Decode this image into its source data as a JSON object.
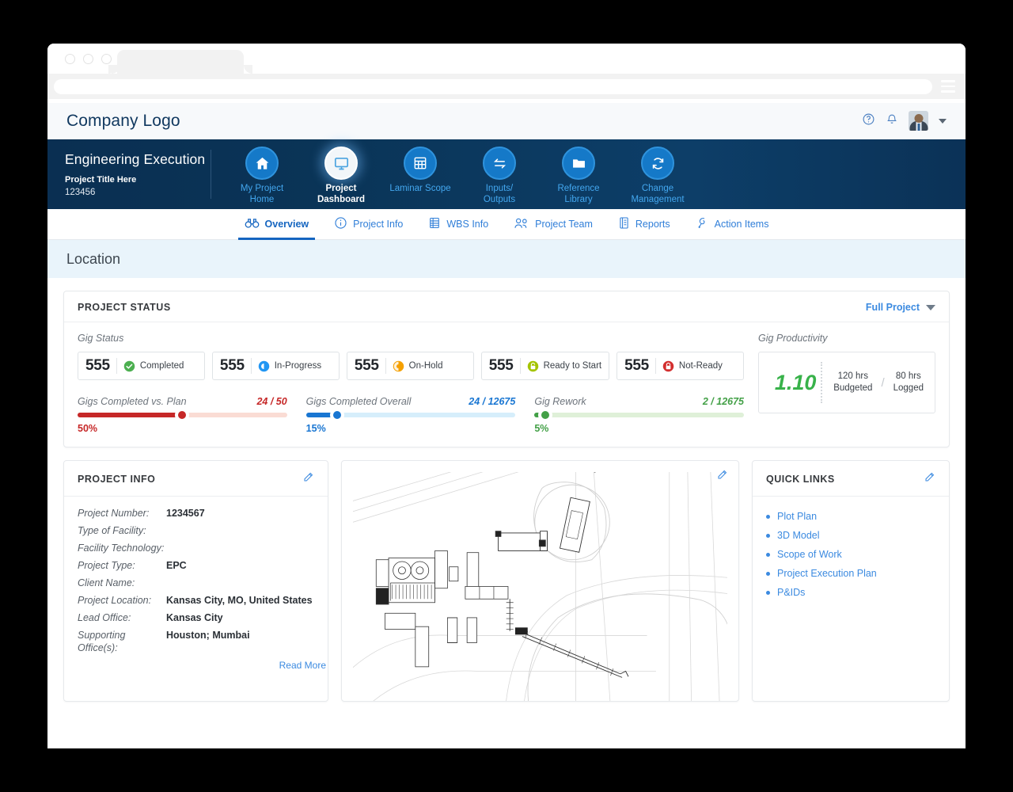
{
  "browser": {
    "tab_label": "",
    "url_value": "",
    "menu_icon": "hamburger-icon"
  },
  "topbar": {
    "logo": "Company Logo",
    "help_icon": "help-circle-icon",
    "bell_icon": "bell-icon",
    "avatar_icon": "user-avatar",
    "chevron_icon": "chevron-down-icon"
  },
  "project_header": {
    "program": "Engineering Execution",
    "title": "Project Title Here",
    "number": "123456"
  },
  "mainnav": [
    {
      "label_line1": "My Project",
      "label_line2": "Home",
      "icon": "home-icon",
      "active": false
    },
    {
      "label_line1": "Project",
      "label_line2": "Dashboard",
      "icon": "monitor-icon",
      "active": true
    },
    {
      "label_line1": "Laminar Scope",
      "label_line2": "",
      "icon": "grid-table-icon",
      "active": false
    },
    {
      "label_line1": "Inputs/",
      "label_line2": "Outputs",
      "icon": "exchange-arrows-icon",
      "active": false
    },
    {
      "label_line1": "Reference",
      "label_line2": "Library",
      "icon": "folder-icon",
      "active": false
    },
    {
      "label_line1": "Change",
      "label_line2": "Management",
      "icon": "refresh-cycle-icon",
      "active": false
    }
  ],
  "subtabs": [
    {
      "label": "Overview",
      "icon": "binoculars-icon",
      "active": true
    },
    {
      "label": "Project Info",
      "icon": "info-circle-icon",
      "active": false
    },
    {
      "label": "WBS Info",
      "icon": "list-table-icon",
      "active": false
    },
    {
      "label": "Project Team",
      "icon": "people-icon",
      "active": false
    },
    {
      "label": "Reports",
      "icon": "report-document-icon",
      "active": false
    },
    {
      "label": "Action Items",
      "icon": "pin-icon",
      "active": false
    }
  ],
  "location_banner": {
    "title": "Location"
  },
  "project_status": {
    "title": "PROJECT STATUS",
    "scope_selector": "Full Project",
    "chevron_icon": "chevron-down-icon",
    "gig_status_label": "Gig Status",
    "chips": [
      {
        "count": "555",
        "label": "Completed",
        "icon": "check-circle-icon",
        "color": "#4caf50"
      },
      {
        "count": "555",
        "label": "In-Progress",
        "icon": "progress-circle-icon",
        "color": "#2196f3"
      },
      {
        "count": "555",
        "label": "On-Hold",
        "icon": "pause-circle-icon",
        "color": "#f5a000"
      },
      {
        "count": "555",
        "label": "Ready to Start",
        "icon": "unlocked-lock-icon",
        "color": "#a4c400"
      },
      {
        "count": "555",
        "label": "Not-Ready",
        "icon": "locked-lock-icon",
        "color": "#d32f2f"
      }
    ],
    "bars": [
      {
        "name": "Gigs Completed vs. Plan",
        "ratio": "24 / 50",
        "percent": "50%",
        "value": 50,
        "color": "#c62828",
        "track": "#fadcd4"
      },
      {
        "name": "Gigs Completed Overall",
        "ratio": "24 / 12675",
        "percent": "15%",
        "value": 15,
        "color": "#1976d2",
        "track": "#d6eefb"
      },
      {
        "name": "Gig Rework",
        "ratio": "2 / 12675",
        "percent": "5%",
        "value": 5,
        "color": "#43a047",
        "track": "#dff0d8"
      }
    ],
    "productivity": {
      "label": "Gig Productivity",
      "value": "1.10",
      "budgeted": "120 hrs",
      "budgeted_label": "Budgeted",
      "logged": "80 hrs",
      "logged_label": "Logged",
      "separator": "/"
    }
  },
  "project_info": {
    "title": "PROJECT INFO",
    "edit_icon": "pencil-edit-icon",
    "read_more": "Read More",
    "fields": [
      {
        "key": "Project Number:",
        "value": "1234567"
      },
      {
        "key": "Type of Facility:",
        "value": ""
      },
      {
        "key": "Facility Technology:",
        "value": ""
      },
      {
        "key": "Project Type:",
        "value": "EPC"
      },
      {
        "key": "Client Name:",
        "value": ""
      },
      {
        "key": "Project Location:",
        "value": "Kansas City, MO, United States"
      },
      {
        "key": "Lead Office:",
        "value": "Kansas City"
      },
      {
        "key": "Supporting Office(s):",
        "value": "Houston; Mumbai"
      }
    ]
  },
  "plot_plan": {
    "edit_icon": "pencil-edit-icon",
    "image_name": "site-plot-plan-drawing"
  },
  "quick_links": {
    "title": "QUICK LINKS",
    "edit_icon": "pencil-edit-icon",
    "items": [
      "Plot Plan",
      "3D Model",
      "Scope of Work",
      "Project Execution Plan",
      "P&IDs"
    ]
  }
}
